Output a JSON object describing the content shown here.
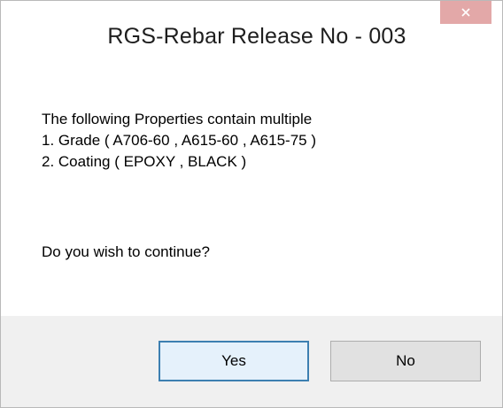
{
  "dialog": {
    "title": "RGS-Rebar Release No - 003",
    "message_lines": [
      "The following Properties contain multiple",
      "1. Grade ( A706-60 , A615-60 , A615-75 )",
      "2. Coating ( EPOXY , BLACK )"
    ],
    "question": "Do you wish to continue?",
    "buttons": {
      "yes_label": "Yes",
      "no_label": "No"
    },
    "close_icon": "close-icon"
  },
  "colors": {
    "close_button_bg": "#e3a8a8",
    "default_button_border": "#3c7fb1",
    "button_bar_bg": "#f0f0f0",
    "content_bg": "#ffffff"
  }
}
